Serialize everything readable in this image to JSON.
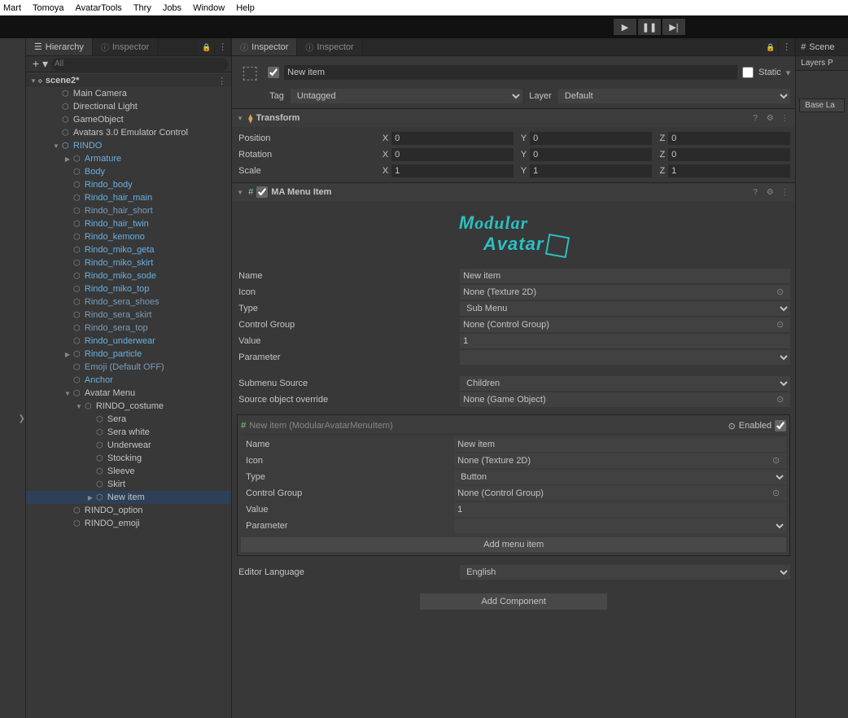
{
  "menubar": [
    "Mart",
    "Tomoya",
    "AvatarTools",
    "Thry",
    "Jobs",
    "Window",
    "Help"
  ],
  "toolbar": {
    "play": "▶",
    "pause": "❚❚",
    "step": "▶|"
  },
  "hierarchy": {
    "tab_main": "Hierarchy",
    "tab_second": "Inspector",
    "search_placeholder": "All",
    "scene": "scene2*",
    "nodes": [
      {
        "label": "Main Camera",
        "indent": 2,
        "prefab": false
      },
      {
        "label": "Directional Light",
        "indent": 2,
        "prefab": false
      },
      {
        "label": "GameObject",
        "indent": 2,
        "prefab": false
      },
      {
        "label": "Avatars 3.0 Emulator Control",
        "indent": 2,
        "prefab": false
      },
      {
        "label": "RINDO",
        "indent": 2,
        "prefab": true,
        "fold": "▼",
        "cube_prefab": true
      },
      {
        "label": "Armature",
        "indent": 3,
        "prefab": true,
        "fold": "▶"
      },
      {
        "label": "Body",
        "indent": 3,
        "prefab": true
      },
      {
        "label": "Rindo_body",
        "indent": 3,
        "prefab": true
      },
      {
        "label": "Rindo_hair_main",
        "indent": 3,
        "prefab": true
      },
      {
        "label": "Rindo_hair_short",
        "indent": 3,
        "prefab": true,
        "override": true
      },
      {
        "label": "Rindo_hair_twin",
        "indent": 3,
        "prefab": true
      },
      {
        "label": "Rindo_kemono",
        "indent": 3,
        "prefab": true
      },
      {
        "label": "Rindo_miko_geta",
        "indent": 3,
        "prefab": true
      },
      {
        "label": "Rindo_miko_skirt",
        "indent": 3,
        "prefab": true
      },
      {
        "label": "Rindo_miko_sode",
        "indent": 3,
        "prefab": true
      },
      {
        "label": "Rindo_miko_top",
        "indent": 3,
        "prefab": true
      },
      {
        "label": "Rindo_sera_shoes",
        "indent": 3,
        "prefab": true,
        "override": true
      },
      {
        "label": "Rindo_sera_skirt",
        "indent": 3,
        "prefab": true,
        "override": true
      },
      {
        "label": "Rindo_sera_top",
        "indent": 3,
        "prefab": true,
        "override": true
      },
      {
        "label": "Rindo_underwear",
        "indent": 3,
        "prefab": true
      },
      {
        "label": "Rindo_particle",
        "indent": 3,
        "prefab": true,
        "fold": "▶"
      },
      {
        "label": "Emoji (Default OFF)",
        "indent": 3,
        "prefab": true,
        "override": true
      },
      {
        "label": "Anchor",
        "indent": 3,
        "prefab": true
      },
      {
        "label": "Avatar Menu",
        "indent": 3,
        "prefab": false,
        "fold": "▼"
      },
      {
        "label": "RINDO_costume",
        "indent": 4,
        "prefab": false,
        "fold": "▼"
      },
      {
        "label": "Sera",
        "indent": 5,
        "prefab": false
      },
      {
        "label": "Sera white",
        "indent": 5,
        "prefab": false
      },
      {
        "label": "Underwear",
        "indent": 5,
        "prefab": false
      },
      {
        "label": "Stocking",
        "indent": 5,
        "prefab": false
      },
      {
        "label": "Sleeve",
        "indent": 5,
        "prefab": false
      },
      {
        "label": "Skirt",
        "indent": 5,
        "prefab": false
      },
      {
        "label": "New item",
        "indent": 5,
        "prefab": false,
        "fold": "▶",
        "selected": true
      },
      {
        "label": "RINDO_option",
        "indent": 3,
        "prefab": false
      },
      {
        "label": "RINDO_emoji",
        "indent": 3,
        "prefab": false
      }
    ]
  },
  "inspector": {
    "tab1": "Inspector",
    "tab2": "Inspector",
    "go_name": "New item",
    "static": "Static",
    "tag_label": "Tag",
    "tag_value": "Untagged",
    "layer_label": "Layer",
    "layer_value": "Default",
    "transform": {
      "title": "Transform",
      "position": "Position",
      "rotation": "Rotation",
      "scale": "Scale",
      "pos": {
        "x": "0",
        "y": "0",
        "z": "0"
      },
      "rot": {
        "x": "0",
        "y": "0",
        "z": "0"
      },
      "scl": {
        "x": "1",
        "y": "1",
        "z": "1"
      }
    },
    "ma": {
      "title": "MA Menu Item",
      "logo": "Modular Avatar",
      "name_label": "Name",
      "name_value": "New item",
      "icon_label": "Icon",
      "icon_value": "None (Texture 2D)",
      "type_label": "Type",
      "type_value": "Sub Menu",
      "cg_label": "Control Group",
      "cg_value": "None (Control Group)",
      "value_label": "Value",
      "value_value": "1",
      "param_label": "Parameter",
      "param_value": "",
      "submenu_src_label": "Submenu Source",
      "submenu_src_value": "Children",
      "src_override_label": "Source object override",
      "src_override_value": "None (Game Object)",
      "nested": {
        "title": "New item (ModularAvatarMenuItem)",
        "enabled_label": "Enabled",
        "name_label": "Name",
        "name_value": "New item",
        "icon_label": "Icon",
        "icon_value": "None (Texture 2D)",
        "type_label": "Type",
        "type_value": "Button",
        "cg_label": "Control Group",
        "cg_value": "None (Control Group)",
        "value_label": "Value",
        "value_value": "1",
        "param_label": "Parameter",
        "param_value": "",
        "add_menu": "Add menu item"
      },
      "editor_lang_label": "Editor Language",
      "editor_lang_value": "English"
    },
    "add_component": "Add Component"
  },
  "scene_panel": {
    "tab": "Scene",
    "layers": "Layers",
    "p": "P",
    "base": "Base La"
  }
}
